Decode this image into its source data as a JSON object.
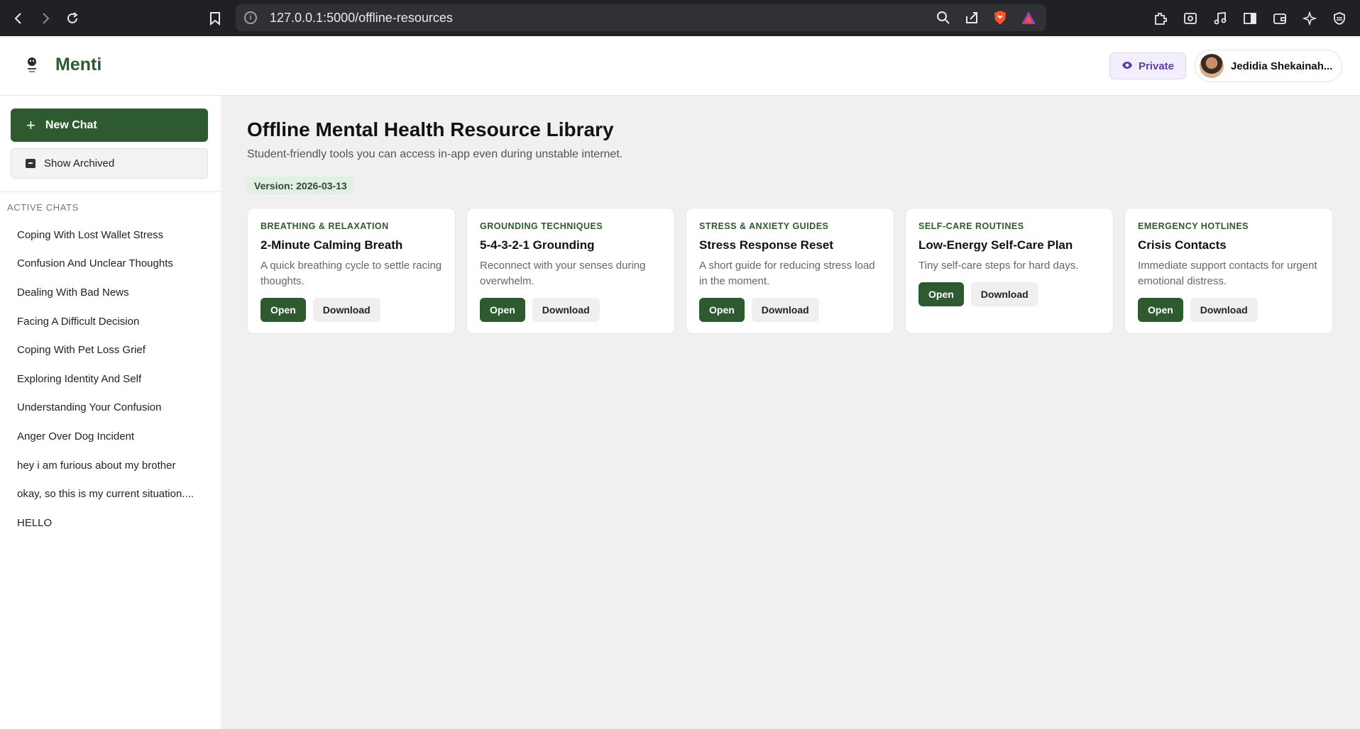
{
  "browser": {
    "url": "127.0.0.1:5000/offline-resources",
    "nav_icons": [
      "back-arrow-icon",
      "forward-arrow-icon",
      "reload-icon"
    ],
    "toolbar_icons": [
      "zoom-icon",
      "share-icon",
      "brave-shield-icon",
      "brave-rewards-icon",
      "extensions-icon",
      "screenshot-icon",
      "media-icon",
      "sidebar-icon",
      "wallet-icon",
      "leo-ai-icon",
      "vpn-icon"
    ]
  },
  "header": {
    "brand": "Menti",
    "private_label": "Private",
    "user_name": "Jedidia Shekainah..."
  },
  "sidebar": {
    "new_chat_label": "New Chat",
    "show_archived_label": "Show Archived",
    "section_title": "ACTIVE CHATS",
    "chats": [
      "Coping With Lost Wallet Stress",
      "Confusion And Unclear Thoughts",
      "Dealing With Bad News",
      "Facing A Difficult Decision",
      "Coping With Pet Loss Grief",
      "Exploring Identity And Self",
      "Understanding Your Confusion",
      "Anger Over Dog Incident",
      "hey i am furious about my brother",
      "okay, so this is my current situation....",
      "HELLO"
    ]
  },
  "main": {
    "title": "Offline Mental Health Resource Library",
    "subtitle": "Student-friendly tools you can access in-app even during unstable internet.",
    "version": "Version: 2026-03-13",
    "open_label": "Open",
    "download_label": "Download",
    "cards": [
      {
        "category": "BREATHING & RELAXATION",
        "title": "2-Minute Calming Breath",
        "description": "A quick breathing cycle to settle racing thoughts."
      },
      {
        "category": "GROUNDING TECHNIQUES",
        "title": "5-4-3-2-1 Grounding",
        "description": "Reconnect with your senses during overwhelm."
      },
      {
        "category": "STRESS & ANXIETY GUIDES",
        "title": "Stress Response Reset",
        "description": "A short guide for reducing stress load in the moment."
      },
      {
        "category": "SELF-CARE ROUTINES",
        "title": "Low-Energy Self-Care Plan",
        "description": "Tiny self-care steps for hard days."
      },
      {
        "category": "EMERGENCY HOTLINES",
        "title": "Crisis Contacts",
        "description": "Immediate support contacts for urgent emotional distress."
      }
    ]
  },
  "colors": {
    "brand_green": "#2d5a2f",
    "private_purple": "#5b3fa8",
    "main_bg": "#f0f0f0"
  }
}
